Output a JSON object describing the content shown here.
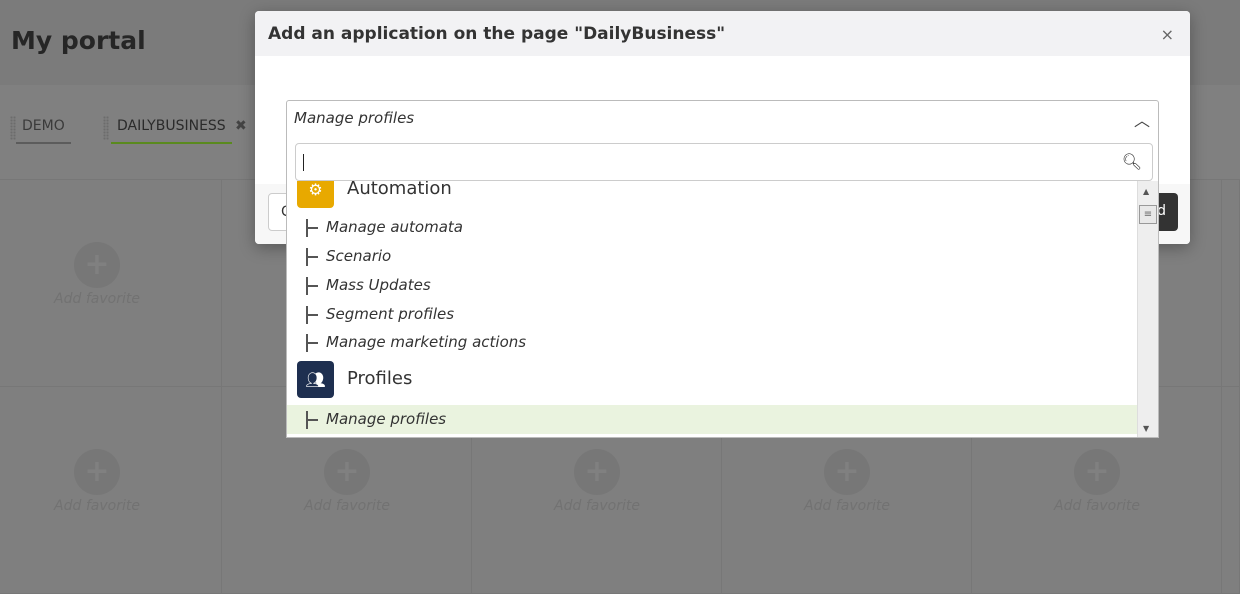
{
  "page": {
    "title": "My portal",
    "tabs": [
      {
        "label": "DEMO",
        "active": false
      },
      {
        "label": "DAILYBUSINESS",
        "active": true,
        "close_icon": "close-x-icon"
      }
    ],
    "tile_label": "Add favorite",
    "tile_icon": "plus-circle-icon"
  },
  "modal": {
    "title": "Add an application on the page \"DailyBusiness\"",
    "close_label": "×",
    "cancel_label": "C",
    "add_label": "d"
  },
  "select": {
    "value": "Manage profiles",
    "search_value": "",
    "search_icon": "search-icon"
  },
  "groups": [
    {
      "label": "Automation",
      "icon": "gears-icon",
      "color": "#e8a900",
      "items": [
        "Manage automata",
        "Scenario",
        "Mass Updates",
        "Segment profiles",
        "Manage marketing actions"
      ]
    },
    {
      "label": "Profiles",
      "icon": "users-icon",
      "color": "#1e2f50",
      "items": [
        "Manage profiles"
      ],
      "selected": "Manage profiles"
    }
  ],
  "colors": {
    "selected_row": "#eaf3df",
    "active_tab_underline": "#5a8a1e"
  }
}
